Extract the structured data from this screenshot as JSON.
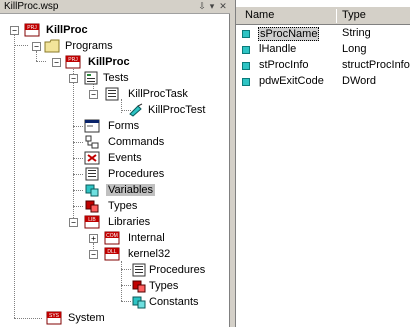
{
  "window": {
    "title": "KillProc.wsp"
  },
  "title_buttons": {
    "pin": "⇩",
    "dropdown": "▾",
    "close": "✕"
  },
  "tree": {
    "root": "KillProc",
    "programs": "Programs",
    "program": "KillProc",
    "tests": "Tests",
    "test_task": "KillProcTask",
    "test": "KillProcTest",
    "forms": "Forms",
    "commands": "Commands",
    "events": "Events",
    "procedures": "Procedures",
    "variables": "Variables",
    "types": "Types",
    "libraries": "Libraries",
    "internal": "Internal",
    "kernel32": "kernel32",
    "k_procedures": "Procedures",
    "k_types": "Types",
    "k_constants": "Constants",
    "system": "System"
  },
  "icon_badges": {
    "prj": "PRJ",
    "lib": "LIB",
    "com": "COM",
    "dll": "DLL",
    "sys": "SYS"
  },
  "variables_list": {
    "headers": {
      "name": "Name",
      "type": "Type"
    },
    "rows": [
      {
        "name": "sProcName",
        "type": "String"
      },
      {
        "name": "lHandle",
        "type": "Long"
      },
      {
        "name": "stProcInfo",
        "type": "structProcInfo"
      },
      {
        "name": "pdwExitCode",
        "type": "DWord"
      }
    ]
  },
  "colors": {
    "accent": "#2ec4c4",
    "selection": "#c0c0c0"
  }
}
